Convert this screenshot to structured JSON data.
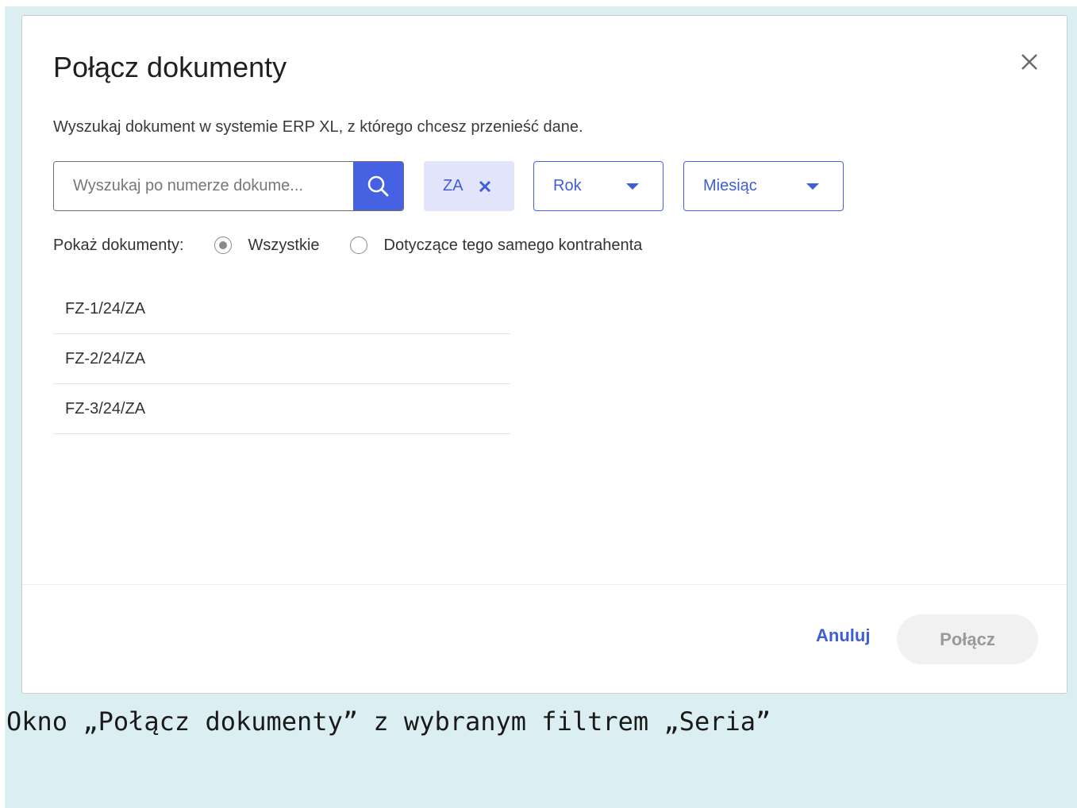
{
  "dialog": {
    "title": "Połącz dokumenty",
    "description": "Wyszukaj dokument w systemie ERP XL, z którego chcesz przenieść dane.",
    "close_icon": "close-icon"
  },
  "search": {
    "placeholder": "Wyszukaj po numerze dokume...",
    "value": "",
    "button_icon": "search-icon"
  },
  "filters": {
    "series_chip": "ZA",
    "year_label": "Rok",
    "month_label": "Miesiąc"
  },
  "show_documents": {
    "label": "Pokaż dokumenty:",
    "options": [
      {
        "label": "Wszystkie",
        "selected": true
      },
      {
        "label": "Dotyczące tego samego kontrahenta",
        "selected": false
      }
    ]
  },
  "documents": [
    "FZ-1/24/ZA",
    "FZ-2/24/ZA",
    "FZ-3/24/ZA"
  ],
  "footer": {
    "cancel_label": "Anuluj",
    "connect_label": "Połącz"
  },
  "caption": "Okno „Połącz dokumenty” z wybranym filtrem „Seria”",
  "colors": {
    "accent": "#4662e3",
    "chip_bg": "#e1e4fb",
    "page_bg": "#dbeef2"
  }
}
